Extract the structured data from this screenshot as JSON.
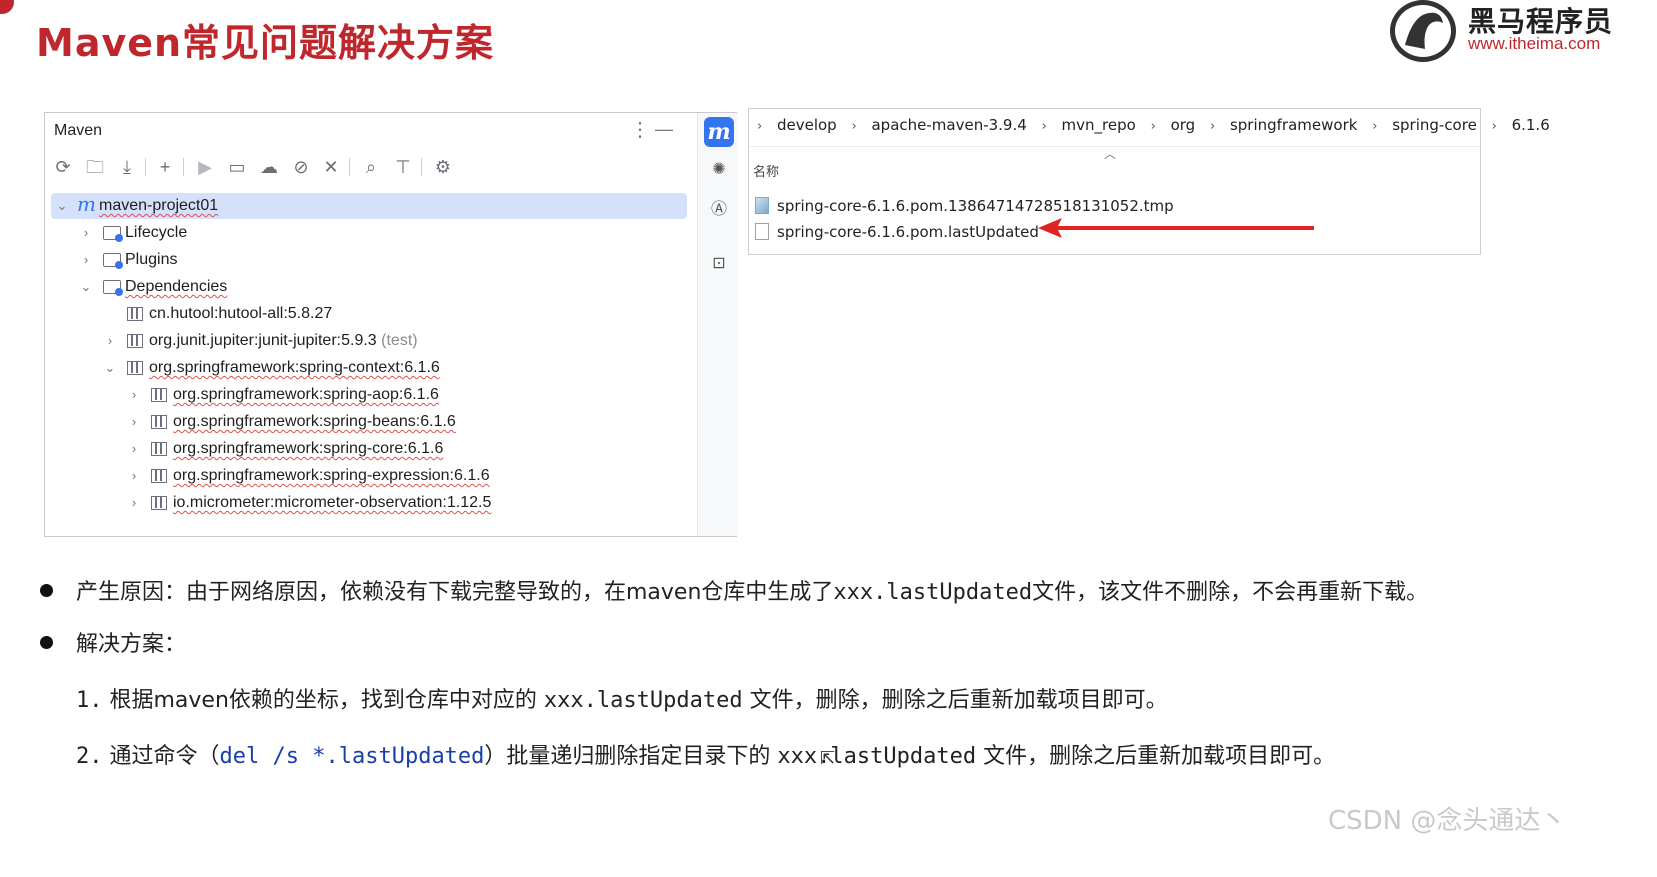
{
  "title": "Maven常见问题解决方案",
  "logo": {
    "name": "黑马程序员",
    "url": "www.itheima.com"
  },
  "maven_panel": {
    "title": "Maven",
    "toolbar_icons": [
      "reload-icon",
      "add-project-icon",
      "download-icon",
      "plus-icon",
      "run-icon",
      "execute-goal-icon",
      "offline-icon",
      "skip-tests-icon",
      "collapse-icon",
      "analyze-icon",
      "show-dependencies-icon",
      "settings-icon"
    ],
    "tree": [
      {
        "label": "maven-project01",
        "kind": "project",
        "level": 0,
        "arrow": "down"
      },
      {
        "label": "Lifecycle",
        "kind": "folder",
        "level": 1,
        "arrow": "right"
      },
      {
        "label": "Plugins",
        "kind": "folder",
        "level": 1,
        "arrow": "right"
      },
      {
        "label": "Dependencies",
        "kind": "folder",
        "level": 1,
        "arrow": "down"
      },
      {
        "label": "cn.hutool:hutool-all:5.8.27",
        "kind": "lib",
        "level": 2,
        "arrow": ""
      },
      {
        "label": "org.junit.jupiter:junit-jupiter:5.9.3",
        "suffix": "(test)",
        "kind": "lib",
        "level": 2,
        "arrow": "right"
      },
      {
        "label": "org.springframework:spring-context:6.1.6",
        "kind": "lib",
        "level": 2,
        "arrow": "down"
      },
      {
        "label": "org.springframework:spring-aop:6.1.6",
        "kind": "lib",
        "level": 3,
        "arrow": "right"
      },
      {
        "label": "org.springframework:spring-beans:6.1.6",
        "kind": "lib",
        "level": 3,
        "arrow": "right"
      },
      {
        "label": "org.springframework:spring-core:6.1.6",
        "kind": "lib",
        "level": 3,
        "arrow": "right"
      },
      {
        "label": "org.springframework:spring-expression:6.1.6",
        "kind": "lib",
        "level": 3,
        "arrow": "right"
      },
      {
        "label": "io.micrometer:micrometer-observation:1.12.5",
        "kind": "lib",
        "level": 3,
        "arrow": "right"
      }
    ]
  },
  "explorer": {
    "breadcrumbs": [
      "develop",
      "apache-maven-3.9.4",
      "mvn_repo",
      "org",
      "springframework",
      "spring-core",
      "6.1.6"
    ],
    "column_header": "名称",
    "files": [
      {
        "name": "spring-core-6.1.6.pom.1386471472851813105​2.tmp",
        "type": "tmp"
      },
      {
        "name": "spring-core-6.1.6.pom.lastUpdated",
        "type": "file"
      }
    ]
  },
  "bullets": {
    "cause": {
      "prefix": "产生原因：由于网络原因，依赖没有下载完整导致的，在maven仓库中生成了",
      "code": "xxx.lastUpdated",
      "suffix": "文件，该文件不删除，不会再重新下载。"
    },
    "solution_label": "解决方案：",
    "step1": {
      "num": "1.",
      "prefix": "根据maven依赖的坐标，找到仓库中对应的 ",
      "code": "xxx.lastUpdated",
      "suffix": " 文件，删除，删除之后重新加载项目即可。"
    },
    "step2": {
      "num": "2.",
      "prefix": "通过命令（",
      "cmd": "del /s *.lastUpdated",
      "mid": "）批量递归删除指定目录下的 ",
      "code": "xxx.lastUpdated",
      "suffix": " 文件，删除之后重新加载项目即可。"
    }
  },
  "watermark": "CSDN @念头通达丶",
  "colors": {
    "title": "#c0272d",
    "accent": "#3574f0",
    "arrow": "#e02424",
    "command": "#1a3ea8"
  }
}
